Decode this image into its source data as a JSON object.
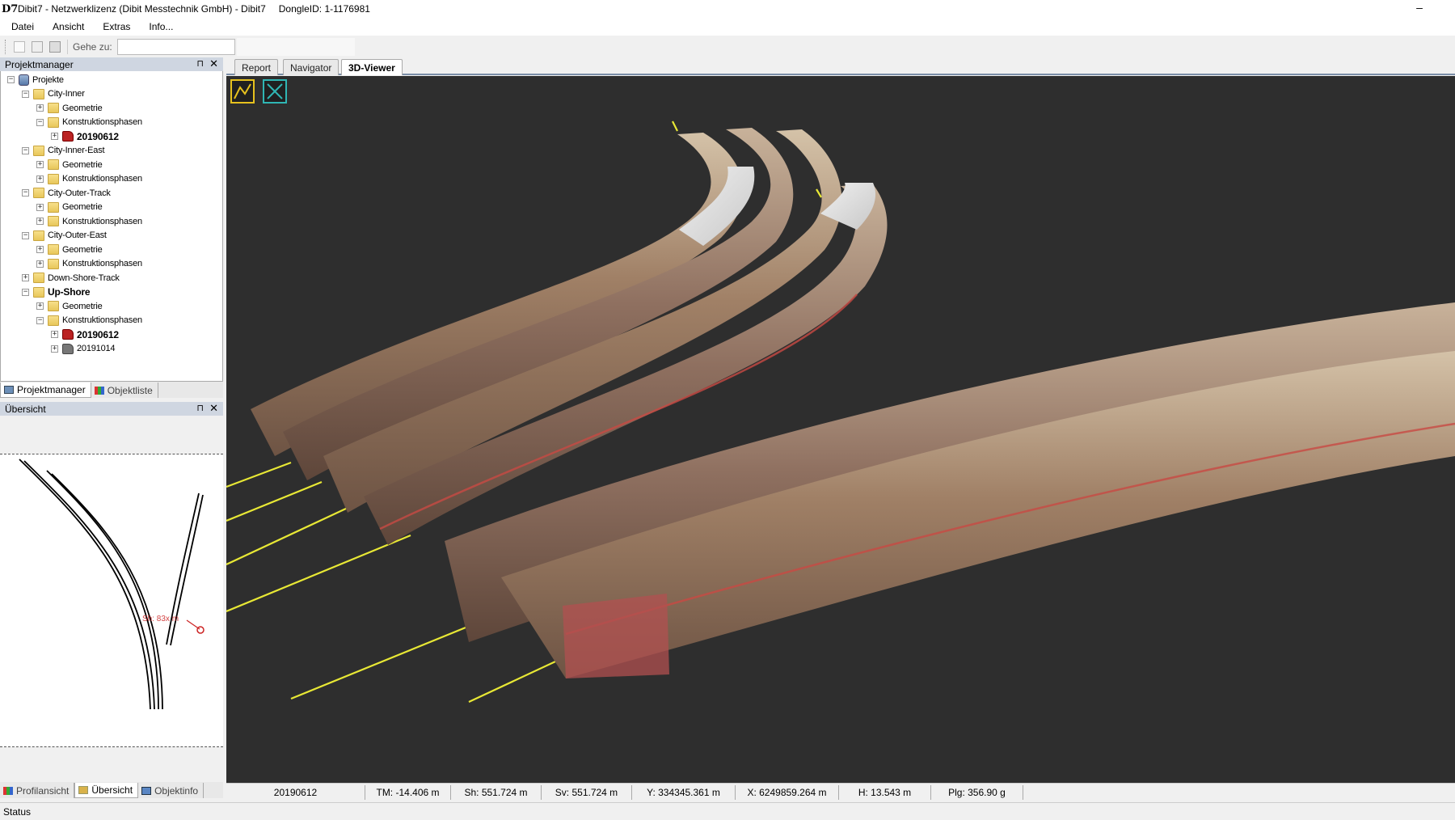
{
  "window": {
    "logo": "D7",
    "title": "Dibit7 - Netzwerklizenz (Dibit Messtechnik GmbH) - Dibit7",
    "dongle": "DongleID:  1-1176981",
    "minimize": "–"
  },
  "menu": [
    "Datei",
    "Ansicht",
    "Extras",
    "Info..."
  ],
  "toolbar": {
    "goto_label": "Gehe zu:",
    "goto_value": ""
  },
  "project_manager": {
    "title": "Projektmanager",
    "pin": "⊓",
    "close": "✕",
    "tree": [
      {
        "label": "Projekte",
        "level": 0,
        "icon": "database",
        "expander": "−"
      },
      {
        "label": "City-Inner",
        "level": 1,
        "icon": "folder",
        "expander": "−"
      },
      {
        "label": "Geometrie",
        "level": 2,
        "icon": "folder",
        "expander": "+"
      },
      {
        "label": "Konstruktionsphasen",
        "level": 2,
        "icon": "folder",
        "expander": "−"
      },
      {
        "label": "20190612",
        "level": 3,
        "icon": "phase-active",
        "expander": "+",
        "bold": true
      },
      {
        "label": "City-Inner-East",
        "level": 1,
        "icon": "folder",
        "expander": "−"
      },
      {
        "label": "Geometrie",
        "level": 2,
        "icon": "folder",
        "expander": "+"
      },
      {
        "label": "Konstruktionsphasen",
        "level": 2,
        "icon": "folder",
        "expander": "+"
      },
      {
        "label": "City-Outer-Track",
        "level": 1,
        "icon": "folder",
        "expander": "−"
      },
      {
        "label": "Geometrie",
        "level": 2,
        "icon": "folder",
        "expander": "+"
      },
      {
        "label": "Konstruktionsphasen",
        "level": 2,
        "icon": "folder",
        "expander": "+"
      },
      {
        "label": "City-Outer-East",
        "level": 1,
        "icon": "folder",
        "expander": "−"
      },
      {
        "label": "Geometrie",
        "level": 2,
        "icon": "folder",
        "expander": "+"
      },
      {
        "label": "Konstruktionsphasen",
        "level": 2,
        "icon": "folder",
        "expander": "+"
      },
      {
        "label": "Down-Shore-Track",
        "level": 1,
        "icon": "folder",
        "expander": "+"
      },
      {
        "label": "Up-Shore",
        "level": 1,
        "icon": "folder",
        "expander": "−",
        "bold": true
      },
      {
        "label": "Geometrie",
        "level": 2,
        "icon": "folder",
        "expander": "+"
      },
      {
        "label": "Konstruktionsphasen",
        "level": 2,
        "icon": "folder",
        "expander": "−"
      },
      {
        "label": "20190612",
        "level": 3,
        "icon": "phase-active",
        "expander": "+",
        "bold": true
      },
      {
        "label": "20191014",
        "level": 3,
        "icon": "phase-inactive",
        "expander": "+"
      }
    ],
    "tabs": [
      "Projektmanager",
      "Objektliste"
    ]
  },
  "overview": {
    "title": "Übersicht",
    "pin": "⊓",
    "close": "✕",
    "marker_label": "Sh: 83x m",
    "tabs": [
      "Profilansicht",
      "Übersicht",
      "Objektinfo"
    ]
  },
  "doc_tabs": [
    "Report",
    "Navigator",
    "3D-Viewer"
  ],
  "viewer": {
    "tool_icons": [
      "measure-polyline-icon",
      "fit-view-icon"
    ]
  },
  "infobar": [
    "20190612",
    "TM: -14.406 m",
    "Sh: 551.724 m",
    "Sv: 551.724 m",
    "Y: 334345.361 m",
    "X: 6249859.264 m",
    "H: 13.543 m",
    "Plg: 356.90 g"
  ],
  "status": "Status",
  "colors": {
    "viewer_bg": "#2e2e2e",
    "panel_header": "#cfd6e1",
    "guide_line": "#e8e835",
    "accent_yellow": "#e6c11e",
    "accent_teal": "#2fb6b4"
  }
}
